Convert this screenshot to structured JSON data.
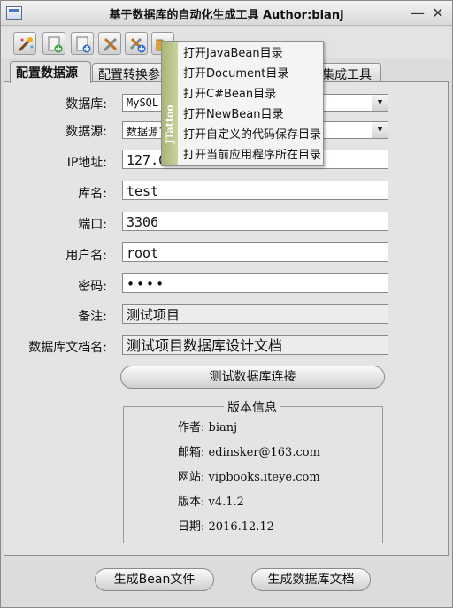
{
  "window": {
    "title": "基于数据库的自动化生成工具 Author:bianj",
    "minimize": "—",
    "close": "✕"
  },
  "toolbar": {
    "buttons": [
      "magic-wand-icon",
      "new-file-icon",
      "add-file-icon",
      "tools-icon",
      "tools-add-icon",
      "folder-icon"
    ]
  },
  "tabs": [
    "配置数据源",
    "配置转换参数",
    "集成工具"
  ],
  "form": {
    "database": {
      "label": "数据库:",
      "value": "MySQL"
    },
    "datasource": {
      "label": "数据源:",
      "value": "数据源1"
    },
    "ip": {
      "label": "IP地址:",
      "value": "127.0"
    },
    "dbname": {
      "label": "库名:",
      "value": "test"
    },
    "port": {
      "label": "端口:",
      "value": "3306"
    },
    "username": {
      "label": "用户名:",
      "value": "root"
    },
    "password": {
      "label": "密码:",
      "value": "••••"
    },
    "remark": {
      "label": "备注:",
      "value": "测试项目"
    },
    "docname": {
      "label": "数据库文档名:",
      "value": "测试项目数据库设计文档"
    }
  },
  "test_button": "测试数据库连接",
  "version_info": {
    "title": "版本信息",
    "author": "作者: bianj",
    "email": "邮箱: edinsker@163.com",
    "website": "网站: vipbooks.iteye.com",
    "version": "版本: v4.1.2",
    "date": "日期: 2016.12.12"
  },
  "bottom_buttons": {
    "gen_bean": "生成Bean文件",
    "gen_doc": "生成数据库文档"
  },
  "menu": {
    "brand": "JTattoo",
    "items": [
      "打开JavaBean目录",
      "打开Document目录",
      "打开C#Bean目录",
      "打开NewBean目录",
      "打开自定义的代码保存目录",
      "打开当前应用程序所在目录"
    ]
  }
}
